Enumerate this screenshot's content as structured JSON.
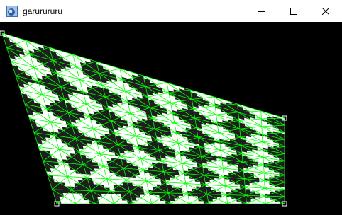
{
  "window": {
    "title": "garurururu",
    "controls": {
      "minimize": "minimize-icon",
      "maximize": "maximize-icon",
      "close": "close-icon"
    }
  },
  "canvas": {
    "background_color": "#000000",
    "mesh_color": "#00ff00",
    "handle_color": "#ffffff",
    "checker_light": "#ffffff",
    "checker_dark": "#1e1e1e",
    "mesh_divisions": {
      "columns": 12,
      "rows": 12
    },
    "checker_squares_per_side": 12,
    "control_handles": [
      "top-left",
      "top-right",
      "bottom-right",
      "bottom-left"
    ]
  }
}
